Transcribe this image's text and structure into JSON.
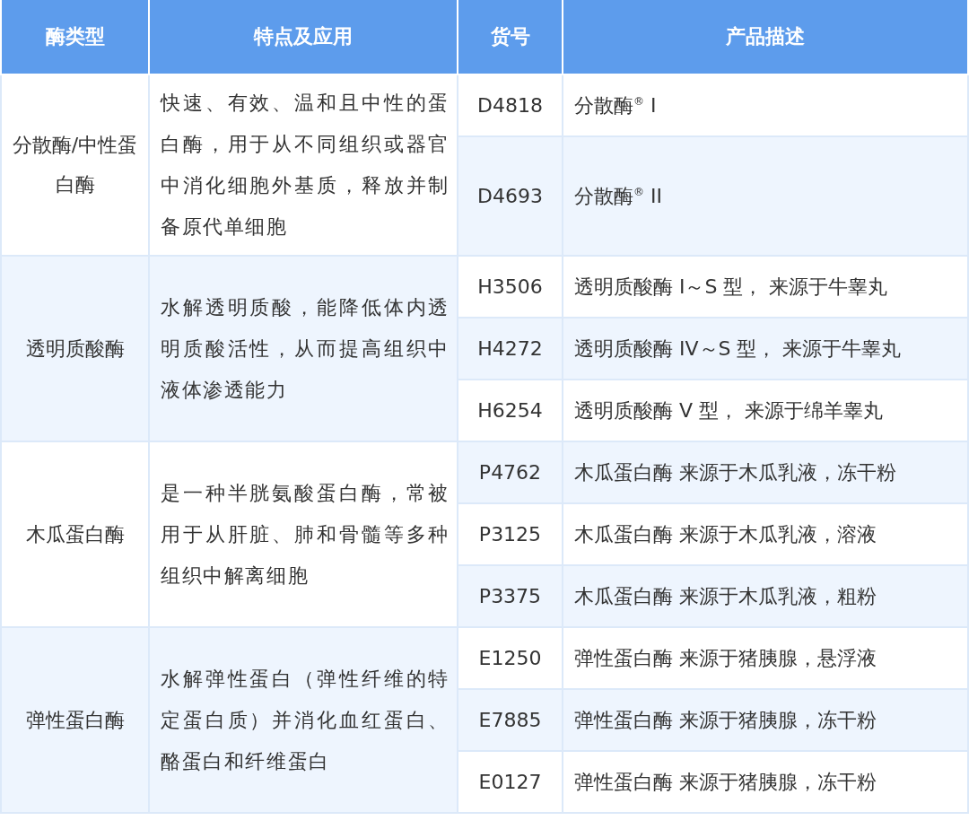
{
  "table": {
    "columns": [
      "酶类型",
      "特点及应用",
      "货号",
      "产品描述"
    ],
    "groups": [
      {
        "enzyme_type": "分散酶/中性蛋白酶",
        "features": "快速、有效、温和且中性的蛋白酶，用于从不同组织或器官中消化细胞外基质，释放并制备原代单细胞",
        "products": [
          {
            "code": "D4818",
            "description": "分散酶$^{®}$ I"
          },
          {
            "code": "D4693",
            "description": "分散酶$^{®}$ II"
          }
        ]
      },
      {
        "enzyme_type": "透明质酸酶",
        "features": "水解透明质酸，能降低体内透明质酸活性，从而提高组织中液体渗透能力",
        "products": [
          {
            "code": "H3506",
            "description": "透明质酸酶 I～S 型， 来源于牛睾丸"
          },
          {
            "code": "H4272",
            "description": "透明质酸酶 IV～S 型， 来源于牛睾丸"
          },
          {
            "code": "H6254",
            "description": "透明质酸酶 V 型， 来源于绵羊睾丸"
          }
        ]
      },
      {
        "enzyme_type": "木瓜蛋白酶",
        "features": "是一种半胱氨酸蛋白酶，常被用于从肝脏、肺和骨髓等多种组织中解离细胞",
        "products": [
          {
            "code": "P4762",
            "description": "木瓜蛋白酶 来源于木瓜乳液，冻干粉"
          },
          {
            "code": "P3125",
            "description": "木瓜蛋白酶 来源于木瓜乳液，溶液"
          },
          {
            "code": "P3375",
            "description": "木瓜蛋白酶 来源于木瓜乳液，粗粉"
          }
        ]
      },
      {
        "enzyme_type": "弹性蛋白酶",
        "features": "水解弹性蛋白（弹性纤维的特定蛋白质）并消化血红蛋白、酪蛋白和纤维蛋白",
        "products": [
          {
            "code": "E1250",
            "description": "弹性蛋白酶 来源于猪胰腺，悬浮液"
          },
          {
            "code": "E7885",
            "description": "弹性蛋白酶 来源于猪胰腺，冻干粉"
          },
          {
            "code": "E0127",
            "description": "弹性蛋白酶 来源于猪胰腺，冻干粉"
          }
        ]
      }
    ]
  }
}
